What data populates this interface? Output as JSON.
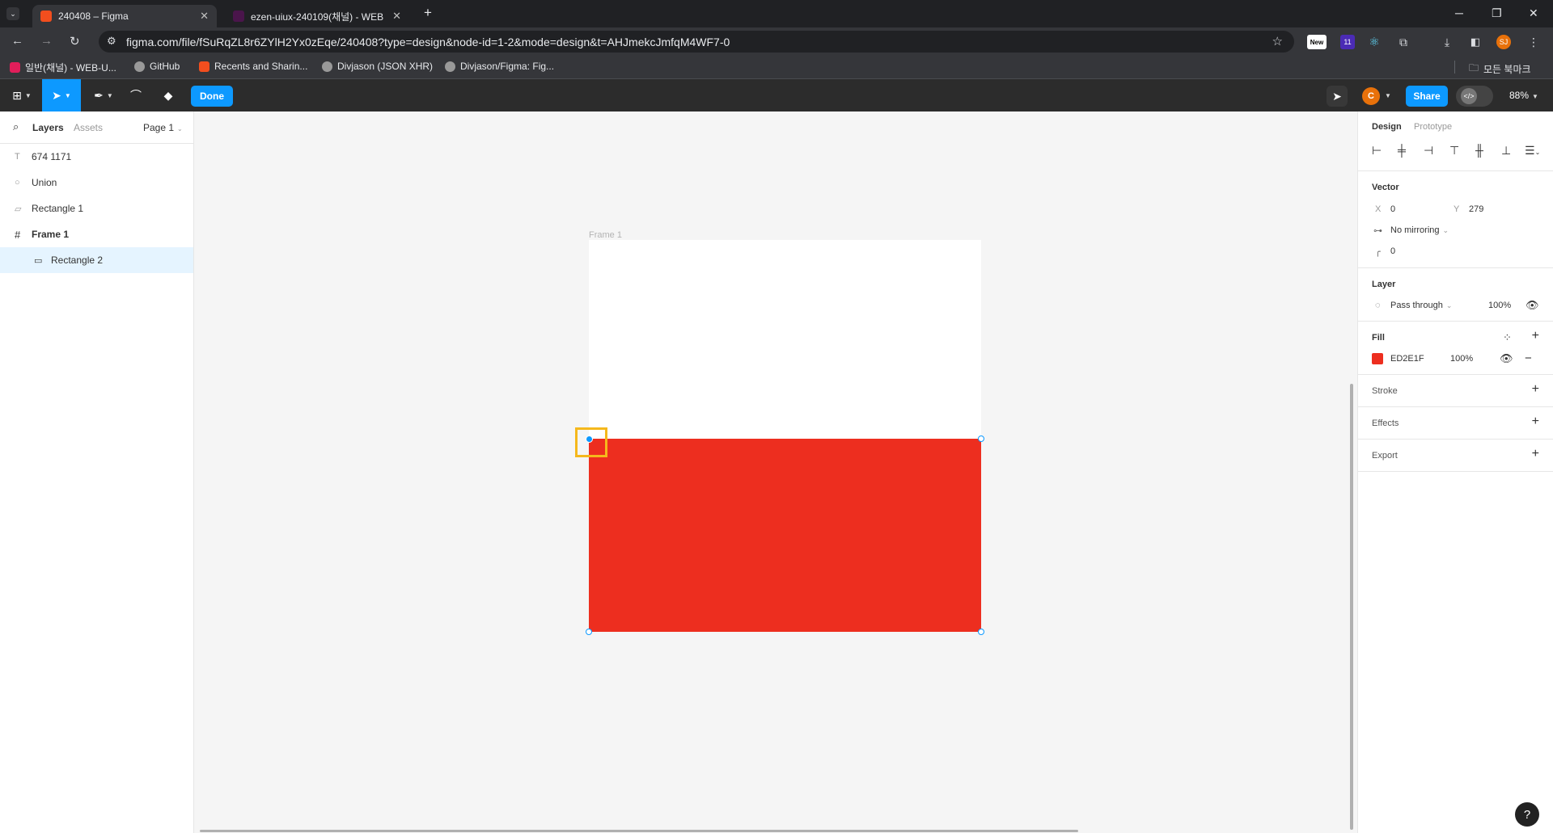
{
  "browser": {
    "tabs": [
      {
        "title": "240408 – Figma",
        "active": true
      },
      {
        "title": "ezen-uiux-240109(채널) - WEB",
        "active": false
      }
    ],
    "url": "figma.com/file/fSuRqZL8r6ZYlH2Yx0zEqe/240408?type=design&node-id=1-2&mode=design&t=AHJmekcJmfqM4WF7-0",
    "extensions": {
      "new_badge": "New",
      "count_badge": "11",
      "profile": "SJ"
    },
    "bookmarks": [
      "일반(채널) - WEB-U...",
      "GitHub",
      "Recents and Sharin...",
      "Divjason (JSON XHR)",
      "Divjason/Figma: Fig..."
    ],
    "all_bookmarks": "모든 북마크"
  },
  "toolbar": {
    "done_label": "Done",
    "share_label": "Share",
    "zoom": "88%",
    "avatar": "C"
  },
  "left_panel": {
    "tabs": {
      "layers": "Layers",
      "assets": "Assets"
    },
    "page": "Page 1",
    "layers": [
      {
        "icon": "T",
        "name": "674 1171"
      },
      {
        "icon": "○",
        "name": "Union"
      },
      {
        "icon": "▱",
        "name": "Rectangle 1"
      },
      {
        "icon": "#",
        "name": "Frame 1"
      },
      {
        "icon": "▭",
        "name": "Rectangle 2"
      }
    ]
  },
  "canvas": {
    "frame_label": "Frame 1",
    "fill_color": "#ED2E1F"
  },
  "right_panel": {
    "tabs": {
      "design": "Design",
      "prototype": "Prototype"
    },
    "vector": {
      "title": "Vector",
      "x_label": "X",
      "x_value": "0",
      "y_label": "Y",
      "y_value": "279",
      "mirroring": "No mirroring",
      "corner": "0"
    },
    "layer": {
      "title": "Layer",
      "blend": "Pass through",
      "opacity": "100%"
    },
    "fill": {
      "title": "Fill",
      "hex": "ED2E1F",
      "opacity": "100%",
      "swatch": "#ED2E1F"
    },
    "stroke": {
      "title": "Stroke"
    },
    "effects": {
      "title": "Effects"
    },
    "export": {
      "title": "Export"
    }
  }
}
